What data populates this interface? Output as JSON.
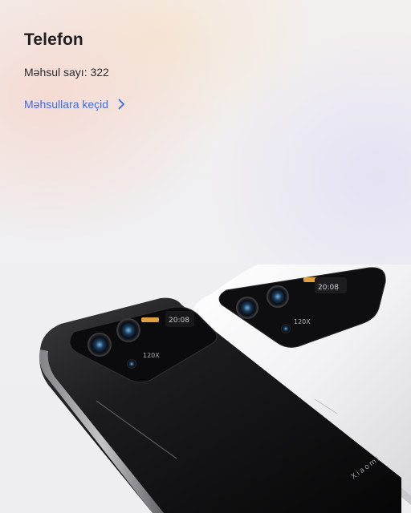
{
  "category": {
    "title": "Telefon",
    "count_text": "Məhsul sayı: 322",
    "link_label": "Məhsullara keçid",
    "link_icon": "chevron-right-icon"
  },
  "product_image": {
    "description_icon": "phone-image",
    "brand_text": "Xiaomi",
    "lens_text": "120X",
    "time_text": "20:08"
  },
  "colors": {
    "link": "#3a6df0",
    "title": "#1f1f22"
  }
}
